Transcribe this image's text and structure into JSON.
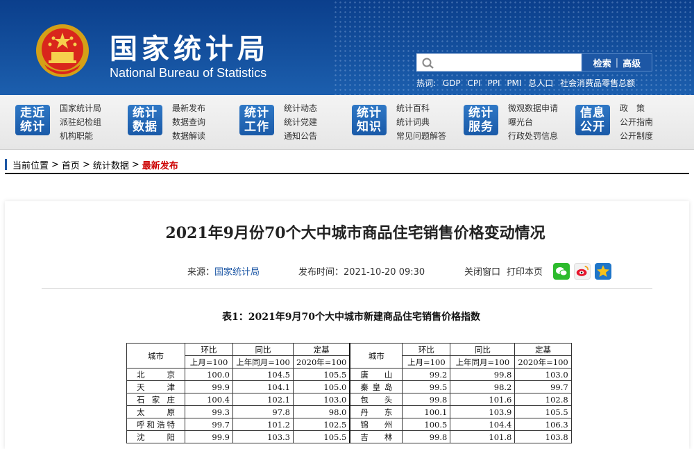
{
  "header": {
    "title_cn": "国家统计局",
    "title_en": "National Bureau of Statistics",
    "search_button": "检索",
    "advanced_button": "高级",
    "hot_label": "热词:",
    "hot_words": [
      "GDP",
      "CPI",
      "PPI",
      "PMI",
      "总人口",
      "社会消费品零售总额"
    ]
  },
  "nav": [
    {
      "badge": [
        "走近",
        "统计"
      ],
      "links": [
        "国家统计局",
        "派驻纪检组",
        "机构职能"
      ]
    },
    {
      "badge": [
        "统计",
        "数据"
      ],
      "links": [
        "最新发布",
        "数据查询",
        "数据解读"
      ]
    },
    {
      "badge": [
        "统计",
        "工作"
      ],
      "links": [
        "统计动态",
        "统计党建",
        "通知公告"
      ]
    },
    {
      "badge": [
        "统计",
        "知识"
      ],
      "links": [
        "统计百科",
        "统计词典",
        "常见问题解答"
      ]
    },
    {
      "badge": [
        "统计",
        "服务"
      ],
      "links": [
        "微观数据申请",
        "曝光台",
        "行政处罚信息"
      ]
    },
    {
      "badge": [
        "信息",
        "公开"
      ],
      "links": [
        "政　策",
        "公开指南",
        "公开制度"
      ]
    }
  ],
  "breadcrumb": {
    "label": "当前位置",
    "items": [
      "首页",
      "统计数据"
    ],
    "current": "最新发布"
  },
  "article": {
    "title": "2021年9月份70个大中城市商品住宅销售价格变动情况",
    "source_label": "来源：",
    "source": "国家统计局",
    "time_label": "发布时间：",
    "time": "2021-10-20 09:30",
    "close_window": "关闭窗口",
    "print_page": "打印本页"
  },
  "table": {
    "title": "表1：2021年9月70个大中城市新建商品住宅销售价格指数",
    "col_city": "城市",
    "col_hb": "环比",
    "col_tb": "同比",
    "col_dj": "定基",
    "sub_hb": "上月=100",
    "sub_tb": "上年同月=100",
    "sub_dj": "2020年=100",
    "rows": [
      {
        "l": {
          "city": "北　京",
          "hb": "100.0",
          "tb": "104.5",
          "dj": "105.5"
        },
        "r": {
          "city": "唐　山",
          "hb": "99.2",
          "tb": "99.8",
          "dj": "103.0"
        }
      },
      {
        "l": {
          "city": "天　津",
          "hb": "99.9",
          "tb": "104.1",
          "dj": "105.0"
        },
        "r": {
          "city": "秦皇岛",
          "hb": "99.5",
          "tb": "98.2",
          "dj": "99.7"
        }
      },
      {
        "l": {
          "city": "石家庄",
          "hb": "100.4",
          "tb": "102.1",
          "dj": "103.0"
        },
        "r": {
          "city": "包　头",
          "hb": "99.8",
          "tb": "101.6",
          "dj": "102.8"
        }
      },
      {
        "l": {
          "city": "太　原",
          "hb": "99.3",
          "tb": "97.8",
          "dj": "98.0"
        },
        "r": {
          "city": "丹　东",
          "hb": "100.1",
          "tb": "103.9",
          "dj": "105.5"
        }
      },
      {
        "l": {
          "city": "呼和浩特",
          "hb": "99.7",
          "tb": "101.2",
          "dj": "102.5"
        },
        "r": {
          "city": "锦　州",
          "hb": "100.5",
          "tb": "104.4",
          "dj": "106.3"
        }
      },
      {
        "l": {
          "city": "沈　阳",
          "hb": "99.9",
          "tb": "103.3",
          "dj": "105.5"
        },
        "r": {
          "city": "吉　林",
          "hb": "99.8",
          "tb": "101.8",
          "dj": "103.8"
        }
      }
    ]
  }
}
